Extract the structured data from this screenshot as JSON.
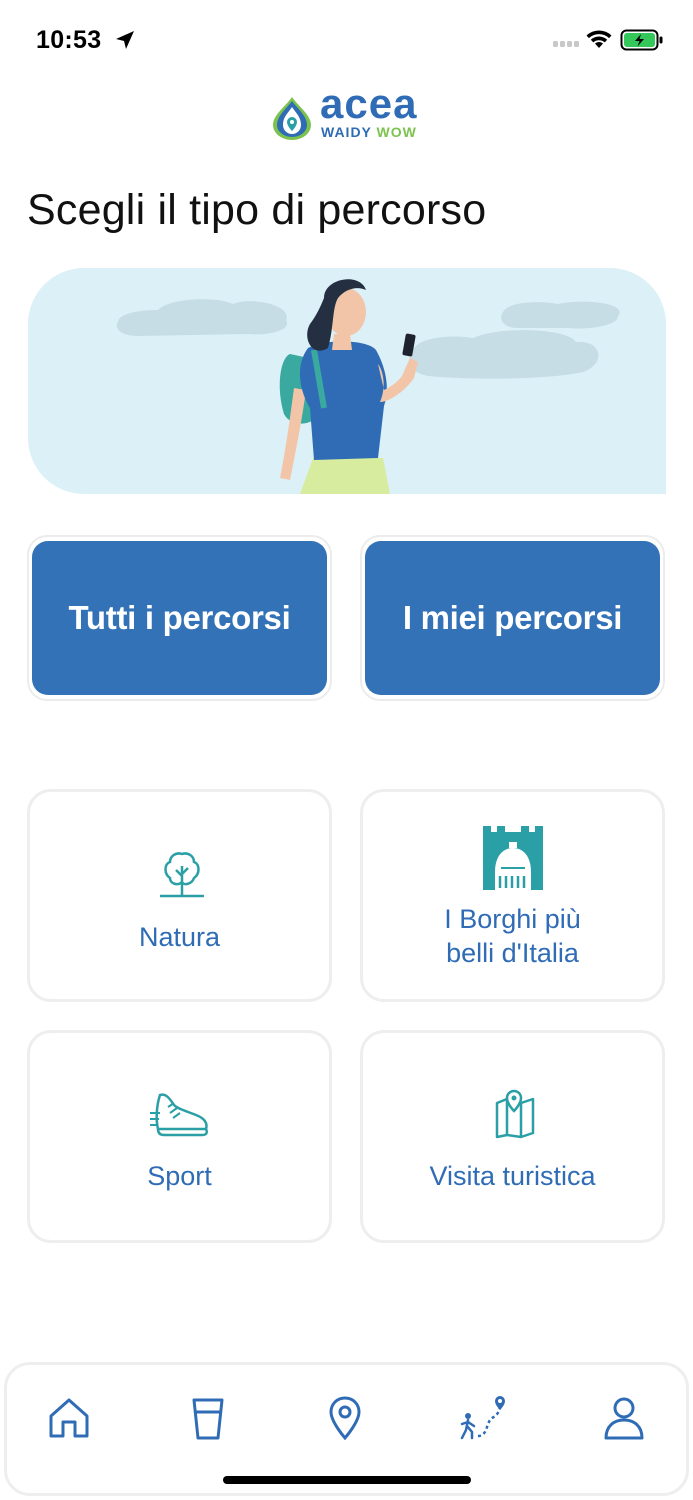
{
  "status_bar": {
    "time": "10:53"
  },
  "logo": {
    "brand": "acea",
    "sub_left": "WAIDY",
    "sub_right": "WOW"
  },
  "page": {
    "title": "Scegli il tipo di percorso"
  },
  "buttons": {
    "all_routes": "Tutti i percorsi",
    "my_routes": "I miei percorsi"
  },
  "categories": [
    {
      "label_line1": "Natura",
      "label_line2": "",
      "icon": "tree-icon"
    },
    {
      "label_line1": "I Borghi più",
      "label_line2": "belli d'Italia",
      "icon": "village-icon"
    },
    {
      "label_line1": "Sport",
      "label_line2": "",
      "icon": "sneaker-icon"
    },
    {
      "label_line1": "Visita turistica",
      "label_line2": "",
      "icon": "map-icon"
    }
  ],
  "nav": [
    "home-icon",
    "water-glass-icon",
    "location-pin-icon",
    "route-walk-icon",
    "profile-icon"
  ],
  "colors": {
    "primary": "#3372b6",
    "text_blue": "#2f6cb5",
    "icon_teal": "#2aa0a6",
    "hero_bg": "#dcf0f7"
  }
}
